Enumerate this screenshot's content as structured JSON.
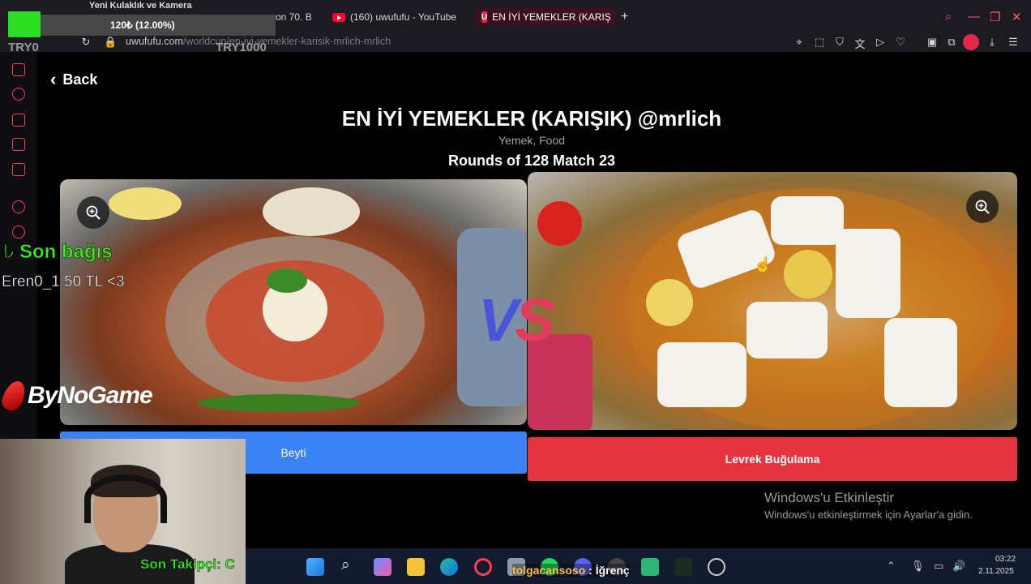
{
  "overlay": {
    "camera_title": "Yeni Kulaklık ve Kamera",
    "progress_text": "120₺ (12.00%)",
    "progress_fraction": 0.12,
    "try_left": "TRY0",
    "try_right": "TRY1000",
    "donation_title": "₺ Son bağış",
    "donation_line": "Eren0_1 50 TL <3",
    "brand": "ByNoGame",
    "follower": "Son Takipçi: C",
    "chat_user": "tolgacansoso",
    "chat_text": " : İğrenç"
  },
  "browser": {
    "tabs": [
      {
        "label": "on 70. B"
      },
      {
        "label": "(160) uwufufu - YouTube"
      },
      {
        "label": "EN İYİ YEMEKLER (KARIŞ"
      }
    ],
    "new_tab": "+",
    "url_host": "uwufufu.com",
    "url_path": "/worldcup/en-iyi-yemekler-karisik-mrlich-mrlich",
    "accent": "#e0294a"
  },
  "page": {
    "back_label": "Back",
    "title": "EN İYİ YEMEKLER (KARIŞIK) @mrlich",
    "subtitle": "Yemek, Food",
    "rounds": "Rounds of 128 Match 23",
    "vs_v": "V",
    "vs_s": "S",
    "left_choice": "Beyti",
    "right_choice": "Levrek Buğulama",
    "left_color": "#3b82f6",
    "right_color": "#e5343f"
  },
  "windows": {
    "activate_title": "Windows'u Etkinleştir",
    "activate_text": "Windows'u etkinleştirmek için Ayarlar'a gidin.",
    "time": "03:22",
    "date": "2.11.2025"
  }
}
